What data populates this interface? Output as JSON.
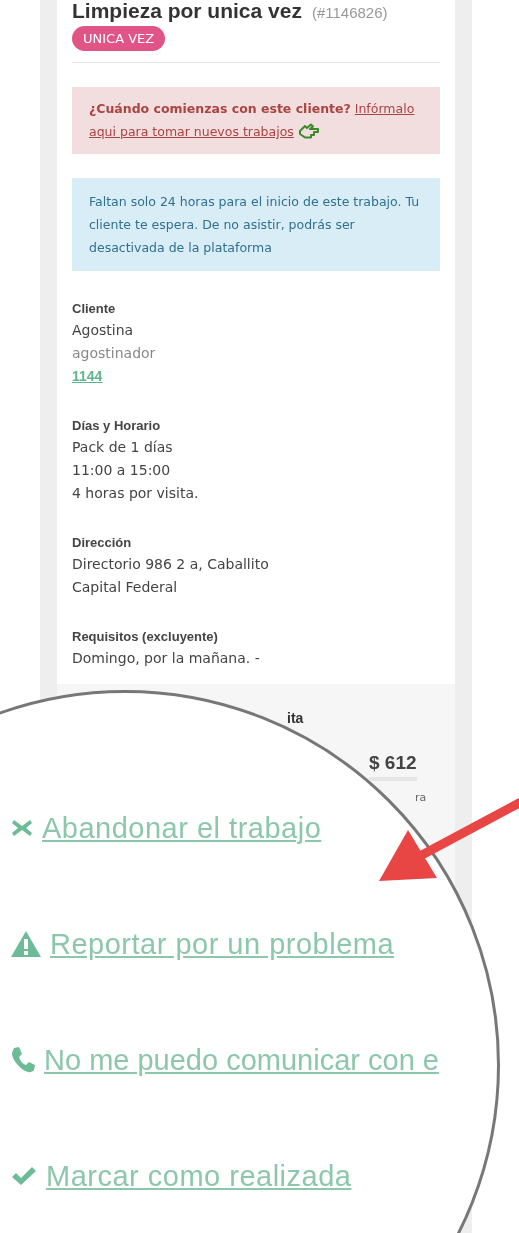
{
  "job": {
    "title": "Limpieza por unica vez",
    "number": "(#1146826)",
    "badge": "UNICA VEZ"
  },
  "alert": {
    "question": "¿Cuándo comienzas con este cliente?",
    "link_lines": [
      "Infórmalo",
      "aqui para tomar nuevos trabajos"
    ]
  },
  "info": {
    "text": "Faltan solo 24 horas para el inicio de este trabajo. Tu cliente te espera. De no asistir, podrás ser desactivada de la plataforma"
  },
  "sections": [
    {
      "label": "Cliente",
      "lines": [
        {
          "kind": "text",
          "text": "Agostina"
        },
        {
          "kind": "faded",
          "text": "agostinador"
        },
        {
          "kind": "phone",
          "text": "1144"
        }
      ]
    },
    {
      "label": "Días y Horario",
      "lines": [
        {
          "kind": "text",
          "text": "Pack de 1 días"
        },
        {
          "kind": "text",
          "text": "11:00 a 15:00"
        },
        {
          "kind": "text",
          "text": "4 horas por visita."
        }
      ]
    },
    {
      "label": "Dirección",
      "lines": [
        {
          "kind": "text",
          "text": "Directorio 986 2 a, Caballito"
        },
        {
          "kind": "text",
          "text": "Capital Federal"
        }
      ]
    },
    {
      "label": "Requisitos  (excluyente)",
      "lines": [
        {
          "kind": "text",
          "text": "Domingo, por la mañana. -"
        }
      ]
    }
  ],
  "price_section": {
    "heading": "ita",
    "price": "$ 612",
    "note": "ra"
  },
  "actions": [
    {
      "kind": "abandon",
      "label": "Abandonar el trabajo"
    },
    {
      "kind": "report",
      "label": "Reportar por un problema"
    },
    {
      "kind": "call",
      "label": "No me puedo comunicar con e"
    },
    {
      "kind": "done",
      "label": "Marcar como realizada"
    }
  ]
}
